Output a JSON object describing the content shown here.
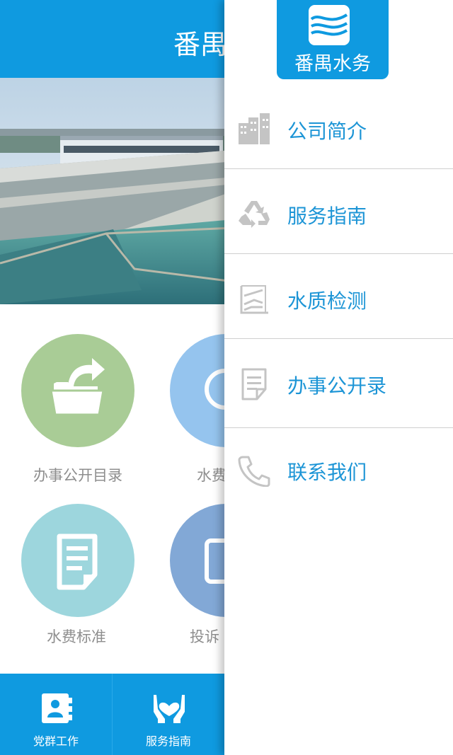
{
  "header": {
    "title": "番禺水务"
  },
  "tiles": [
    {
      "label": "办事公开目录",
      "icon": "folder-share-icon",
      "color": "#a9cc96"
    },
    {
      "label": "水费",
      "icon": "clock-icon",
      "color": "#95c4ee"
    },
    {
      "label": "水费标准",
      "icon": "document-icon",
      "color": "#9dd6dd"
    },
    {
      "label": "投诉",
      "icon": "tablet-icon",
      "color": "#82a8d6"
    }
  ],
  "tabbar": {
    "items": [
      {
        "label": "党群工作",
        "icon": "contacts-book-icon"
      },
      {
        "label": "服务指南",
        "icon": "heart-hands-icon"
      }
    ]
  },
  "drawer": {
    "logo_text": "番禺水务",
    "items": [
      {
        "label": "公司简介",
        "icon": "buildings-icon"
      },
      {
        "label": "服务指南",
        "icon": "recycle-icon"
      },
      {
        "label": "水质检测",
        "icon": "chart-icon"
      },
      {
        "label": "办事公开录",
        "icon": "document-icon"
      },
      {
        "label": "联系我们",
        "icon": "phone-icon"
      }
    ]
  },
  "colors": {
    "primary": "#0f9ae0",
    "menu_text": "#1d95d6",
    "icon_grey": "#c4c4c4"
  }
}
